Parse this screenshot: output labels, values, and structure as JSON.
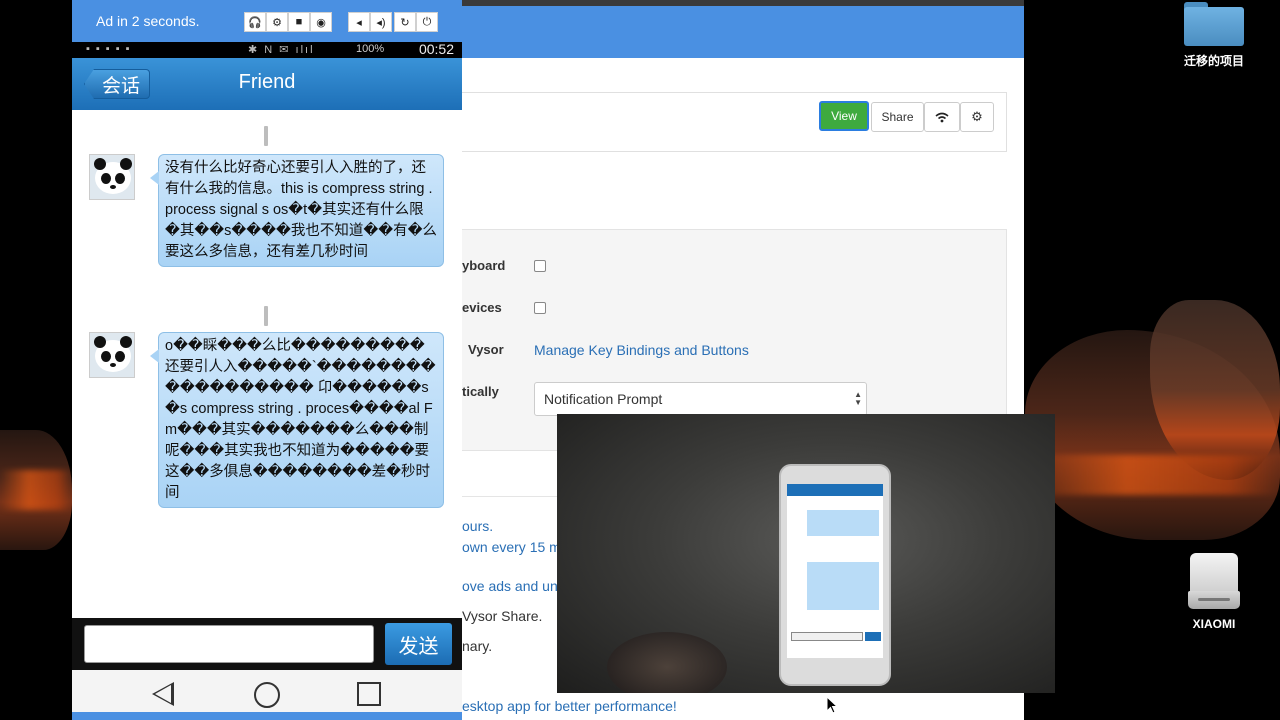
{
  "desktop": {
    "folder_label": "迁移的项目",
    "drive_label": "XIAOMI"
  },
  "adbar": {
    "text": "Ad in 2 seconds.",
    "icons": [
      "headphones-icon",
      "gear-icon",
      "camera-video-icon",
      "camera-icon",
      "volume-down-icon",
      "volume-up-icon",
      "refresh-icon",
      "power-icon"
    ]
  },
  "statusbar": {
    "battery": "100%",
    "time": "00:52"
  },
  "chat": {
    "back_label": "会话",
    "title": "Friend",
    "messages": [
      {
        "text": "没有什么比好奇心还要引人入胜的了，还有什么我的信息。this is compress string . process signal s os�t�其实还有什么限�其��s����我也不知道��有�么要这么多信息，还有差几秒时间"
      },
      {
        "text": "o��睬���么比���������还要引人入�����`������������������ 卬������s �s compress string . proces����al Fm���其实�������么���制呢���其实我也不知道为�����要这��多俱息��������差�秒时间"
      }
    ],
    "send_label": "发送"
  },
  "browser": {
    "buttons": {
      "view": "View",
      "share": "Share"
    },
    "settings": [
      {
        "label": "yboard"
      },
      {
        "label": "evices"
      },
      {
        "label": "Vysor",
        "link": "Manage Key Bindings and Buttons"
      },
      {
        "label": "tically",
        "select": "Notification Prompt"
      }
    ],
    "info_lines": [
      {
        "text": "ours."
      },
      {
        "text": "own every 15 m"
      },
      {
        "text": "ove ads and unl"
      },
      {
        "text": "Vysor Share."
      },
      {
        "text": "nary."
      },
      {
        "text": "esktop app for better performance!"
      }
    ]
  },
  "colors": {
    "accent": "#4a90e2",
    "view_button": "#3eaa3e",
    "link": "#2a6fb5",
    "bubble": "#a9d3f5"
  }
}
